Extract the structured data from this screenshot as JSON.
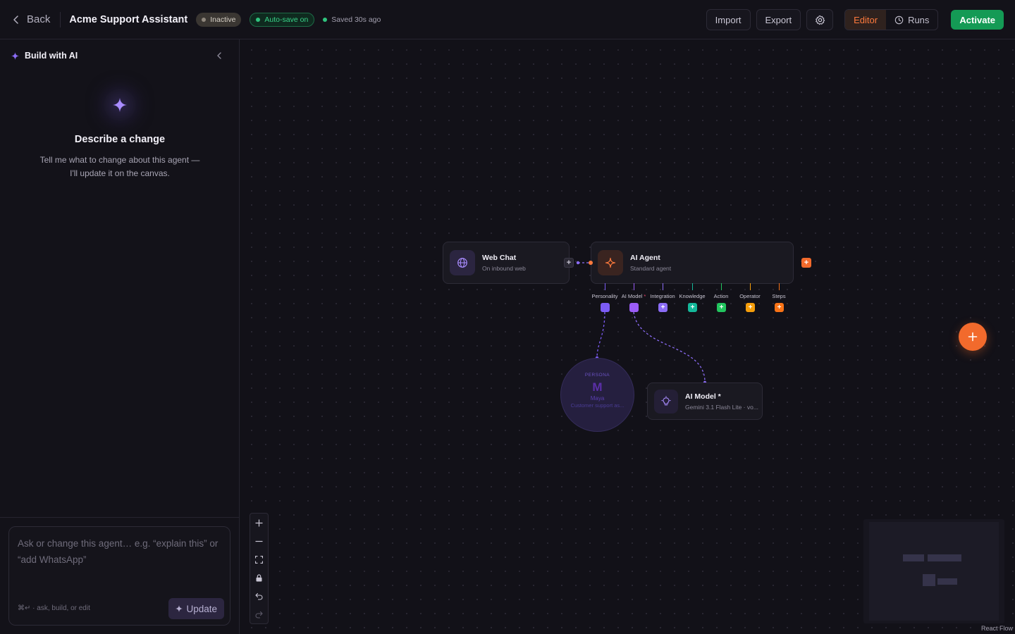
{
  "header": {
    "back_label": "Back",
    "title": "Acme Support Assistant",
    "status_badge": "Inactive",
    "autosave_badge": "Auto-save on",
    "saved_text": "Saved 30s ago",
    "import_label": "Import",
    "export_label": "Export",
    "tabs": [
      {
        "label": "Editor",
        "active": true
      },
      {
        "label": "Runs",
        "active": false
      }
    ],
    "activate_label": "Activate"
  },
  "sidebar": {
    "heading": "Build with AI",
    "empty_title": "Describe a change",
    "empty_body": "Tell me what to change about this agent — I'll update it on the canvas.",
    "composer_placeholder": "Ask or change this agent… e.g. “explain this” or “add WhatsApp”",
    "composer_value": "",
    "composer_hint": "⌘↵ · ask, build, or edit",
    "update_label": "Update"
  },
  "canvas": {
    "nodes": {
      "web_chat": {
        "title": "Web Chat",
        "subtitle": "On inbound web"
      },
      "ai_agent": {
        "title": "AI Agent",
        "subtitle": "Standard agent"
      },
      "ai_model": {
        "title": "AI Model *",
        "subtitle": "Gemini 3.1 Flash Lite · vo..."
      }
    },
    "slots": [
      {
        "label": "Personality",
        "required": false,
        "color": "#7c5cf6"
      },
      {
        "label": "AI Model",
        "required": true,
        "color": "#9b5cf6"
      },
      {
        "label": "Integration",
        "required": false,
        "color": "#8b6cf6"
      },
      {
        "label": "Knowledge",
        "required": false,
        "color": "#14b89a"
      },
      {
        "label": "Action",
        "required": false,
        "color": "#22c55e"
      },
      {
        "label": "Operator",
        "required": false,
        "color": "#f59e0b"
      },
      {
        "label": "Steps",
        "required": false,
        "color": "#f97316"
      }
    ],
    "required_marker": "*",
    "persona": {
      "label": "PERSONA",
      "initial": "M",
      "name": "Maya",
      "description": "Customer support as..."
    },
    "attribution": "React Flow"
  },
  "colors": {
    "accent": "#ff7a3d",
    "activate": "#149a55",
    "success": "#2fc47e",
    "fab": "#f26a2c"
  },
  "icons": {
    "back": "chevron-left-icon",
    "settings": "gear-icon",
    "runs": "clock-icon",
    "sparkle": "sparkle-icon",
    "collapse": "chevron-left-icon",
    "web_chat": "globe-icon",
    "ai_agent": "sparkle-icon",
    "ai_model": "lightbulb-icon",
    "fab": "plus-icon",
    "zoom_in": "plus-icon",
    "zoom_out": "minus-icon",
    "fit_view": "fit-view-icon",
    "lock": "lock-icon",
    "undo": "undo-icon",
    "redo": "redo-icon"
  }
}
